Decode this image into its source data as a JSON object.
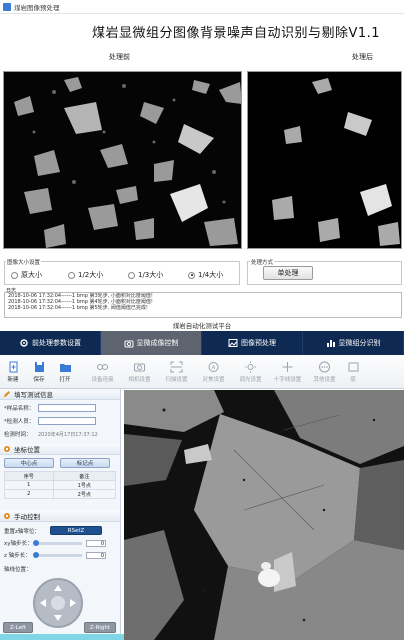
{
  "window": {
    "title": "煤岩图像预处理"
  },
  "heading": "煤岩显微组分图像背景噪声自动识别与剔除V1.1",
  "panels": {
    "before_label": "处理前",
    "after_label": "处理后"
  },
  "size_group": {
    "title": "图像大小设置",
    "options": [
      "原大小",
      "1/2大小",
      "1/3大小",
      "1/4大小"
    ],
    "selected": "1/4大小"
  },
  "process_group": {
    "title": "处理方式",
    "button": "单处理"
  },
  "log": {
    "title": "日志",
    "lines": [
      "2018-10-06 17:32:04------1 bmp 第3轮步,  小面积对比度阈值!",
      "2018-10-06 17:32:04------1 bmp 第4轮步,  小面积对比度阈值!",
      "2018-10-06 17:32:04------1 bmp 第5轮步,  阀值阈值已完成!"
    ]
  },
  "platform_title": "煤岩自动化测试平台",
  "nav": [
    {
      "label": "前处理参数设置",
      "icon": "settings-icon"
    },
    {
      "label": "显微成像控制",
      "icon": "camera-icon"
    },
    {
      "label": "图像预处理",
      "icon": "image-icon"
    },
    {
      "label": "显微组分识别",
      "icon": "bar-chart-icon"
    }
  ],
  "nav_active": 1,
  "toolbar": {
    "main": [
      {
        "label": "新建",
        "icon": "new-icon"
      },
      {
        "label": "保存",
        "icon": "save-icon"
      },
      {
        "label": "打开",
        "icon": "open-icon"
      }
    ],
    "disabled": [
      {
        "label": "设备连接",
        "icon": "link-icon"
      },
      {
        "label": "相机设置",
        "icon": "camera-icon"
      },
      {
        "label": "扫描设置",
        "icon": "scan-icon"
      },
      {
        "label": "对焦设置",
        "icon": "focus-icon"
      },
      {
        "label": "调光设置",
        "icon": "brightness-icon"
      },
      {
        "label": "十字线设置",
        "icon": "crosshair-icon"
      },
      {
        "label": "其他设置",
        "icon": "more-icon"
      },
      {
        "label": "使",
        "icon": "help-icon"
      }
    ]
  },
  "test_info": {
    "title": "填写测试信息",
    "sample_label": "*样品名称：",
    "tester_label": "*检测人员：",
    "time_label": "检测时间：",
    "time_value": "2020年4月17日17:37:12"
  },
  "coords": {
    "title": "坐标位置",
    "center_button": "中心点",
    "mark_button": "标记点",
    "columns": [
      "序号",
      "备注"
    ],
    "rows": [
      [
        "1",
        "1号点"
      ],
      [
        "2",
        "2号点"
      ]
    ]
  },
  "manual": {
    "title": "手动控制",
    "reset_label": "重置z轴零位：",
    "reset_button": "RSetZ",
    "xy_label": "xy轴步长：",
    "xy_value": "0",
    "z_label": "z 轴步长：",
    "z_value": "0",
    "pos_label": "轴线位置：",
    "zleft": "Z-Left",
    "zright": "Z-Right"
  },
  "colors": {
    "nav_bg": "#0f2a52",
    "nav_active": "#5d6470",
    "accent": "#3a7bd5"
  }
}
